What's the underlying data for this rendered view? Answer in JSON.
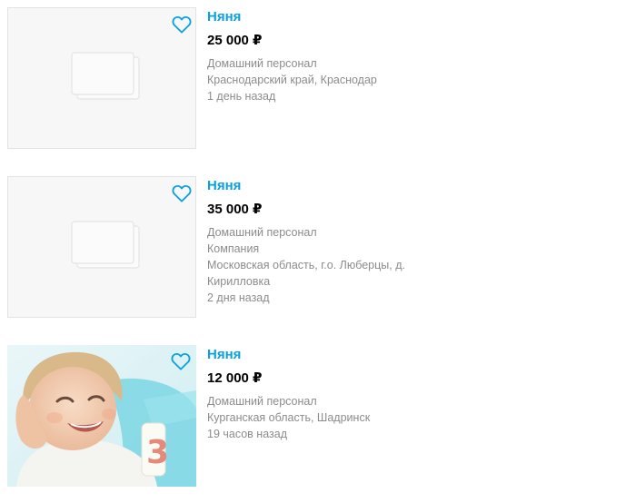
{
  "listings": [
    {
      "title": "Няня",
      "price": "25 000 ₽",
      "category": "Домашний персонал",
      "location_lines": [
        "Краснодарский край, Краснодар"
      ],
      "posted": "1 день назад",
      "image": "placeholder"
    },
    {
      "title": "Няня",
      "price": "35 000 ₽",
      "category": "Домашний персонал",
      "seller": "Компания",
      "location_lines": [
        "Московская область, г.о. Люберцы, д.",
        "Кирилловка"
      ],
      "posted": "2 дня назад",
      "image": "placeholder"
    },
    {
      "title": "Няня",
      "price": "12 000 ₽",
      "category": "Домашний персонал",
      "location_lines": [
        "Курганская область, Шадринск"
      ],
      "posted": "19 часов назад",
      "image": "child-photo"
    }
  ],
  "icons": {
    "favorite": "heart-outline-icon",
    "placeholder": "image-placeholder-icon"
  },
  "colors": {
    "title_link": "#0aa2dd",
    "price": "#000000",
    "meta_text": "#8c8c8c",
    "thumb_bg": "#f7f7f7"
  }
}
